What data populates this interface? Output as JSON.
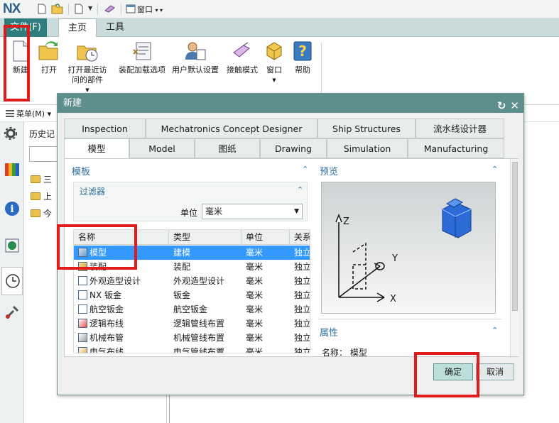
{
  "app": {
    "logo": "NX",
    "window_menu": "窗口"
  },
  "ribbon": {
    "tabs": [
      {
        "label": "文件(F)"
      },
      {
        "label": "主页"
      },
      {
        "label": "工具"
      }
    ],
    "buttons": [
      {
        "label": "新建"
      },
      {
        "label": "打开"
      },
      {
        "label": "打开最近访问的部件"
      },
      {
        "label": "装配加载选项"
      },
      {
        "label": "用户默认设置"
      },
      {
        "label": "接触模式"
      },
      {
        "label": "窗口"
      },
      {
        "label": "帮助"
      }
    ]
  },
  "menubar": {
    "menu_label": "菜单(M)"
  },
  "navigator": {
    "title": "历史记",
    "items": [
      "三",
      "上",
      "今"
    ]
  },
  "dialog": {
    "title": "新建",
    "tabs_row1": [
      "Inspection",
      "Mechatronics Concept Designer",
      "Ship Structures",
      "流水线设计器"
    ],
    "tabs_row2": [
      "模型",
      "Model",
      "图纸",
      "Drawing",
      "Simulation",
      "Manufacturing"
    ],
    "template_group": "模板",
    "filter_group": "过滤器",
    "unit_label": "单位",
    "unit_value": "毫米",
    "table": {
      "headers": [
        "名称",
        "类型",
        "单位",
        "关系"
      ],
      "rows": [
        [
          "模型",
          "建模",
          "毫米",
          "独立"
        ],
        [
          "装配",
          "装配",
          "毫米",
          "独立"
        ],
        [
          "外观造型设计",
          "外观造型设计",
          "毫米",
          "独立"
        ],
        [
          "NX 钣金",
          "钣金",
          "毫米",
          "独立"
        ],
        [
          "航空钣金",
          "航空钣金",
          "毫米",
          "独立"
        ],
        [
          "逻辑布线",
          "逻辑管线布置",
          "毫米",
          "独立"
        ],
        [
          "机械布管",
          "机械管线布置",
          "毫米",
          "独立"
        ],
        [
          "电气布线",
          "电气管线布置",
          "毫米",
          "独立"
        ]
      ]
    },
    "preview_group": "预览",
    "axes": {
      "z": "Z",
      "y": "Y",
      "x": "X"
    },
    "properties_group": "属性",
    "property_name": "名称：  模型",
    "ok_label": "确定",
    "cancel_label": "取消"
  },
  "colors": {
    "dialog_title_bg": "#5d8f8d",
    "highlight_red": "#e01b1b",
    "selection_blue": "#3399ff",
    "file_tab": "#2f7d7d"
  }
}
